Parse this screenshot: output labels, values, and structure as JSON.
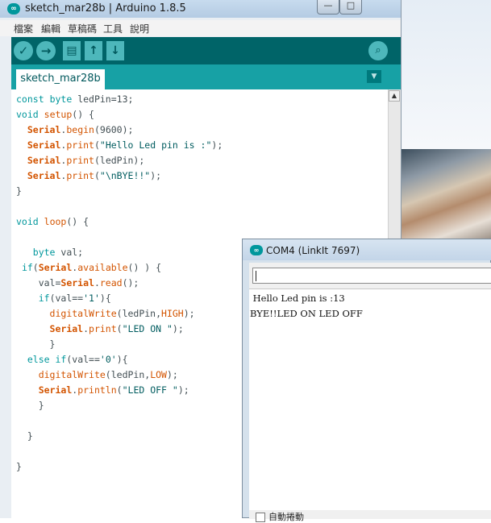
{
  "main_window": {
    "title": "sketch_mar28b | Arduino 1.8.5",
    "logo_text": "∞",
    "menu": [
      "檔案",
      "編輯",
      "草稿碼",
      "工具",
      "說明"
    ],
    "toolbar_icons": [
      "verify-check-icon",
      "upload-arrow-icon",
      "new-file-icon",
      "open-arrow-up-icon",
      "save-arrow-down-icon"
    ],
    "serial_monitor_icon": "magnifier-icon",
    "tab": "sketch_mar28b",
    "window_buttons": [
      "—",
      "□"
    ]
  },
  "code_lines": [
    "const byte ledPin=13;",
    "void setup() {",
    "  Serial.begin(9600);",
    "  Serial.print(\"Hello Led pin is :\");",
    "  Serial.print(ledPin);",
    "  Serial.print(\"\\nBYE!!\");",
    "}",
    "",
    "void loop() {",
    "",
    "   byte val;",
    " if(Serial.available() ) {",
    "    val=Serial.read();",
    "    if(val=='1'){",
    "      digitalWrite(ledPin,HIGH);",
    "      Serial.print(\"LED ON \");",
    "      }",
    "  else if(val=='0'){",
    "    digitalWrite(ledPin,LOW);",
    "    Serial.println(\"LED OFF \");",
    "    }",
    "",
    "  }",
    "",
    "}"
  ],
  "serial_monitor": {
    "title": "COM4 (LinkIt 7697)",
    "input_value": "",
    "output_lines": [
      " Hello Led pin is :13",
      "BYE!!LED ON LED OFF"
    ],
    "autoscroll_label": "自動捲動"
  },
  "colors": {
    "teal_dark": "#006468",
    "teal_tab": "#17a1a5",
    "teal_keyword": "#00979c",
    "orange_function": "#d35400"
  }
}
